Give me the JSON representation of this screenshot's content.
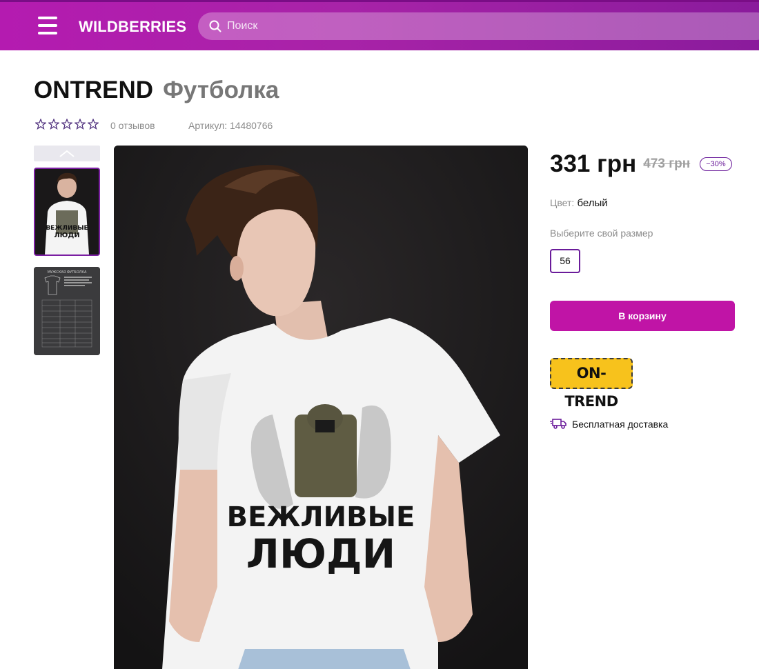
{
  "header": {
    "logo": "WILDBERRIES",
    "search_placeholder": "Поиск",
    "colors": {
      "gradient_start": "#b41bb0",
      "gradient_end": "#8a1b9c"
    }
  },
  "product": {
    "brand": "ONTREND",
    "name": "Футболка",
    "rating_stars": 0,
    "rating_max": 5,
    "reviews": "0 отзывов",
    "article": "Артикул: 14480766"
  },
  "gallery": {
    "thumbnails": [
      {
        "icon": "product-photo-thumbnail",
        "selected": true
      },
      {
        "icon": "size-chart-thumbnail",
        "selected": false,
        "caption": "МУЖСКАЯ ФУТБОЛКА"
      }
    ],
    "main_image_icon": "model-in-tshirt-photo",
    "print_text_1": "ВЕЖЛИВЫЕ",
    "print_text_2": "ЛЮДИ"
  },
  "purchase": {
    "price": "331 грн",
    "old_price": "473 грн",
    "discount": "−30%",
    "color_label": "Цвет:",
    "color_value": "белый",
    "size_title": "Выберите свой размер",
    "sizes": [
      "56"
    ],
    "cart_button": "В корзину",
    "brand_logo": "ON-TREND",
    "delivery": "Бесплатная доставка",
    "accent_color": "#c014a6",
    "outline_color": "#6a1b9a"
  }
}
